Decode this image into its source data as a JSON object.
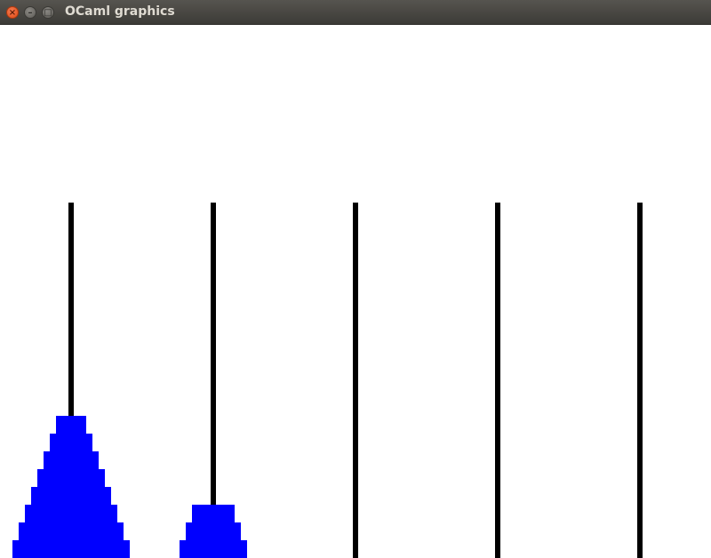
{
  "window": {
    "title": "OCaml graphics",
    "buttons": [
      {
        "name": "close-button",
        "glyph": "×"
      },
      {
        "name": "minimize-button",
        "glyph": "–"
      },
      {
        "name": "maximize-button",
        "glyph": "□"
      }
    ]
  },
  "game": {
    "peg_count": 5,
    "peg_color": "#000000",
    "disk_color": "#0000ff",
    "disk_count": 11,
    "pegs": [
      {
        "index": 1,
        "disks": [
          7,
          6,
          5,
          4,
          3,
          2,
          1,
          0
        ]
      },
      {
        "index": 2,
        "disks": [
          3,
          2,
          1
        ]
      },
      {
        "index": 3,
        "disks": []
      },
      {
        "index": 4,
        "disks": []
      },
      {
        "index": 5,
        "disks": []
      }
    ]
  }
}
